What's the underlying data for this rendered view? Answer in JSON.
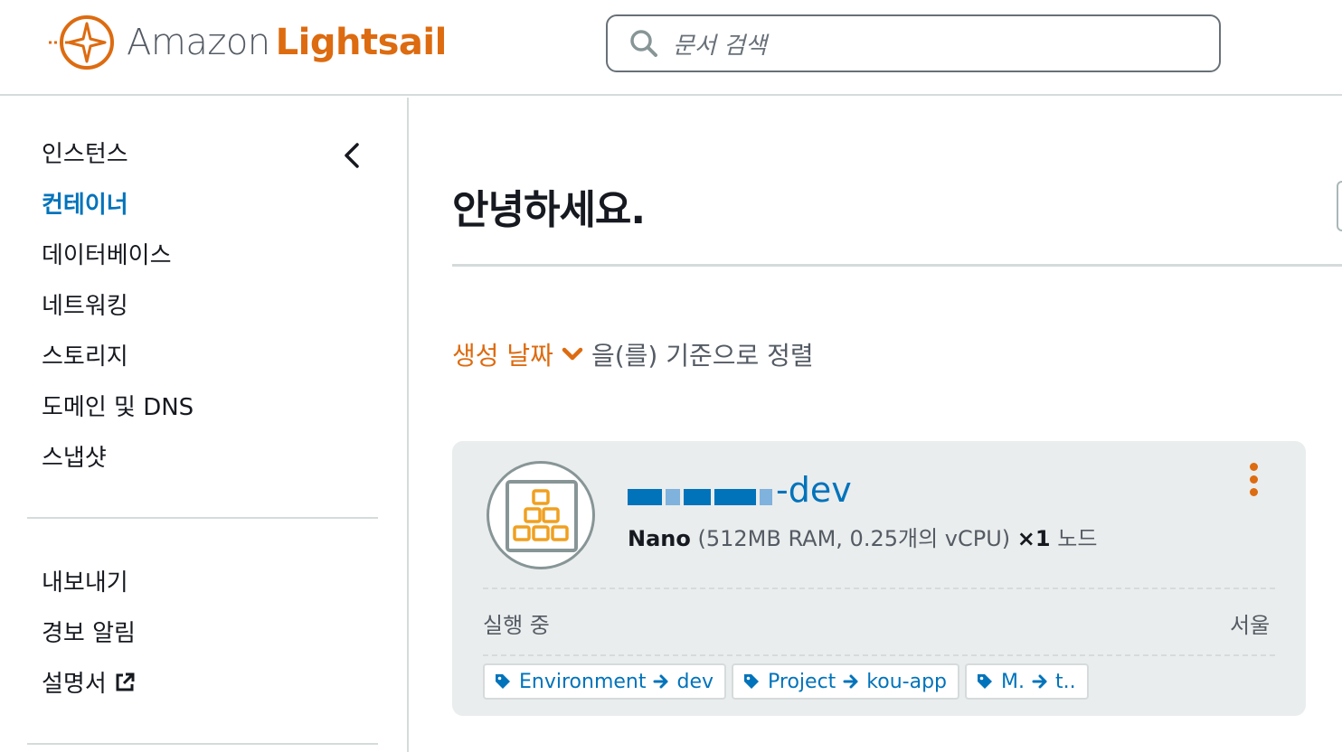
{
  "header": {
    "brand_prefix": "Amazon",
    "brand_name": "Lightsail",
    "search_placeholder": "문서 검색"
  },
  "sidebar": {
    "items": [
      {
        "label": "인스턴스",
        "active": false
      },
      {
        "label": "컨테이너",
        "active": true
      },
      {
        "label": "데이터베이스",
        "active": false
      },
      {
        "label": "네트워킹",
        "active": false
      },
      {
        "label": "스토리지",
        "active": false
      },
      {
        "label": "도메인 및 DNS",
        "active": false
      },
      {
        "label": "스냅샷",
        "active": false
      }
    ],
    "secondary_items": [
      {
        "label": "내보내기"
      },
      {
        "label": "경보 알림"
      },
      {
        "label": "설명서"
      }
    ]
  },
  "main": {
    "greeting": "안녕하세요.",
    "sort_field": "생성 날짜",
    "sort_suffix": "을(를) 기준으로 정렬"
  },
  "container": {
    "name_suffix": "-dev",
    "plan": "Nano",
    "spec": "(512MB RAM, 0.25개의 vCPU)",
    "scale": "×1",
    "node_label": "노드",
    "status": "실행 중",
    "region": "서울",
    "tags": [
      {
        "key": "Environment",
        "value": "dev"
      },
      {
        "key": "Project",
        "value": "kou-app"
      },
      {
        "key": "M.",
        "value": "t.."
      }
    ]
  },
  "colors": {
    "accent_orange": "#dd6b10",
    "link_blue": "#0073bb",
    "card_bg": "#eaeded"
  }
}
